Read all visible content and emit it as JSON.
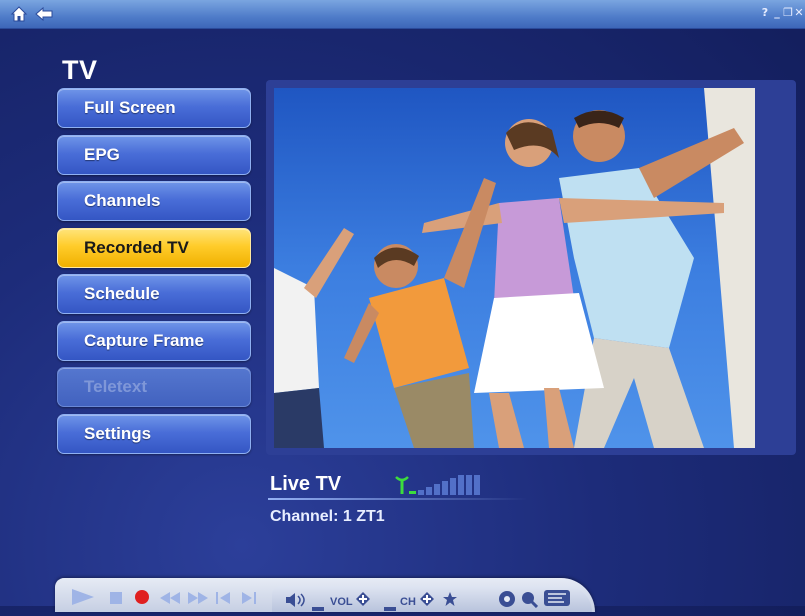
{
  "app": {
    "title": "TV"
  },
  "menu": [
    {
      "label": "Full Screen",
      "state": "normal"
    },
    {
      "label": "EPG",
      "state": "normal"
    },
    {
      "label": "Channels",
      "state": "normal"
    },
    {
      "label": "Recorded TV",
      "state": "selected"
    },
    {
      "label": "Schedule",
      "state": "normal"
    },
    {
      "label": "Capture Frame",
      "state": "normal"
    },
    {
      "label": "Teletext",
      "state": "disabled"
    },
    {
      "label": "Settings",
      "state": "normal"
    }
  ],
  "status": {
    "live_label": "Live TV",
    "channel_text": "Channel: 1 ZT1",
    "signal_icon": "antenna-signal-icon"
  },
  "controls": {
    "vol_label": "VOL",
    "ch_label": "CH"
  },
  "colors": {
    "accent": "#ffcc2a",
    "button": "#4a6ed8",
    "background": "#1d2c7a"
  }
}
